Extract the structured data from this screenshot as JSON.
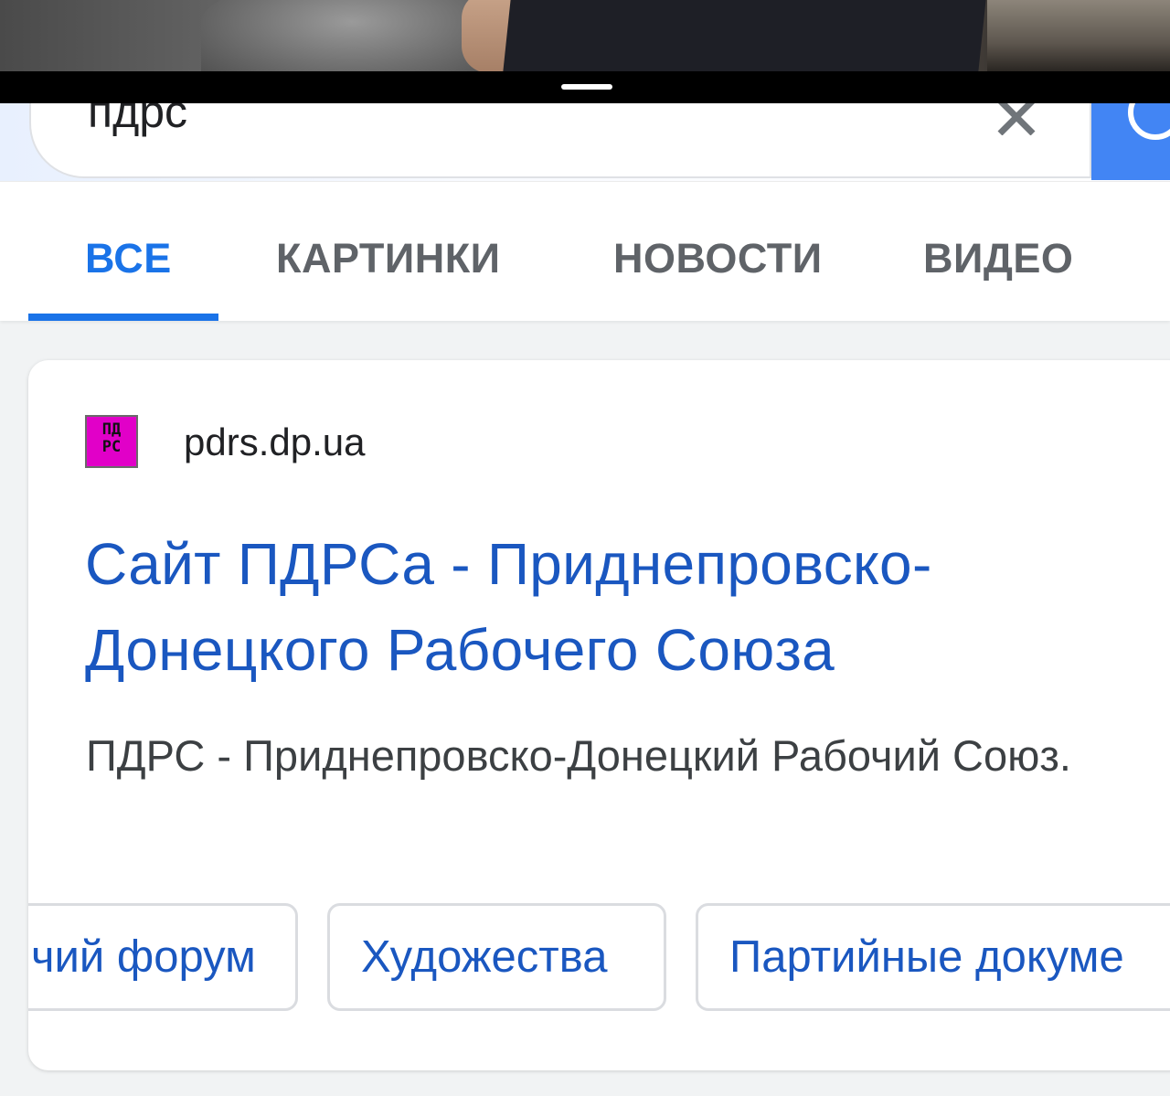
{
  "search": {
    "query": "пдрс"
  },
  "tabs": [
    {
      "label": "ВСЕ",
      "active": true
    },
    {
      "label": "КАРТИНКИ",
      "active": false
    },
    {
      "label": "НОВОСТИ",
      "active": false
    },
    {
      "label": "ВИДЕО",
      "active": false
    }
  ],
  "result": {
    "favicon_text_top": "ПД",
    "favicon_text_bottom": "РС",
    "site": "pdrs.dp.ua",
    "title": "Сайт ПДРСа - Приднепровско-Донецкого Рабочего Союза",
    "snippet": "ПДРС - Приднепровско-Донецкий Рабочий Союз.",
    "chips": [
      "чий форум",
      "Художества",
      "Партийные докуме"
    ]
  },
  "colors": {
    "accent": "#1a73e8",
    "link": "#1a57c0",
    "favicon": "#e100c8",
    "search_button": "#4285f4"
  }
}
